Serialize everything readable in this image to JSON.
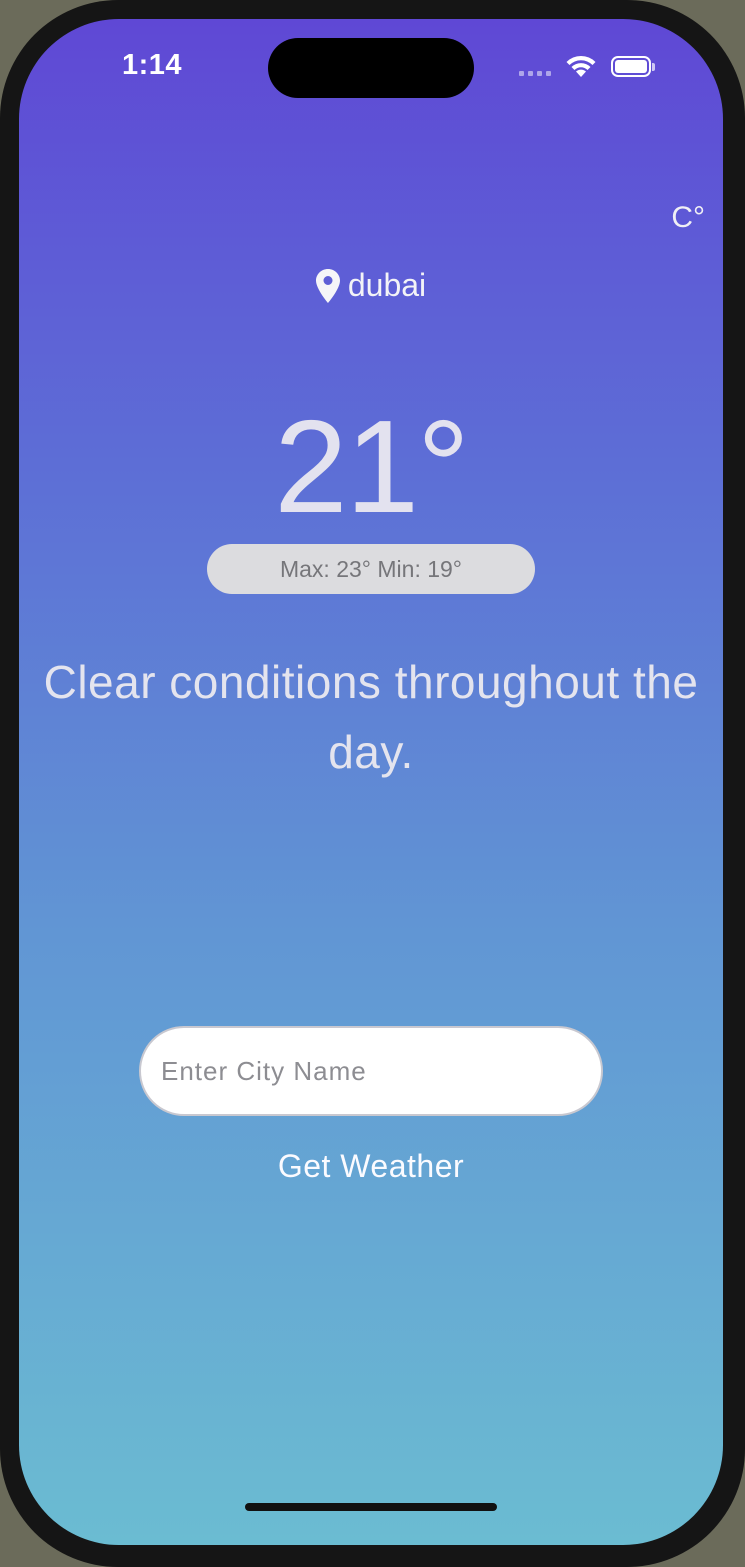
{
  "status_bar": {
    "time": "1:14"
  },
  "unit_toggle": "C°",
  "location": {
    "city": "dubai"
  },
  "weather": {
    "temperature": "21°",
    "min_max": "Max: 23° Min: 19°",
    "description": "Clear conditions throughout the day."
  },
  "search": {
    "placeholder": "Enter City Name",
    "value": ""
  },
  "get_weather_label": "Get Weather",
  "colors": {
    "gradient_top": "#5f48d5",
    "gradient_bottom": "#6bbcd2",
    "text_primary": "#f3f3f7"
  },
  "icons": [
    "location-pin-icon",
    "wifi-icon",
    "battery-icon",
    "signal-icon"
  ]
}
